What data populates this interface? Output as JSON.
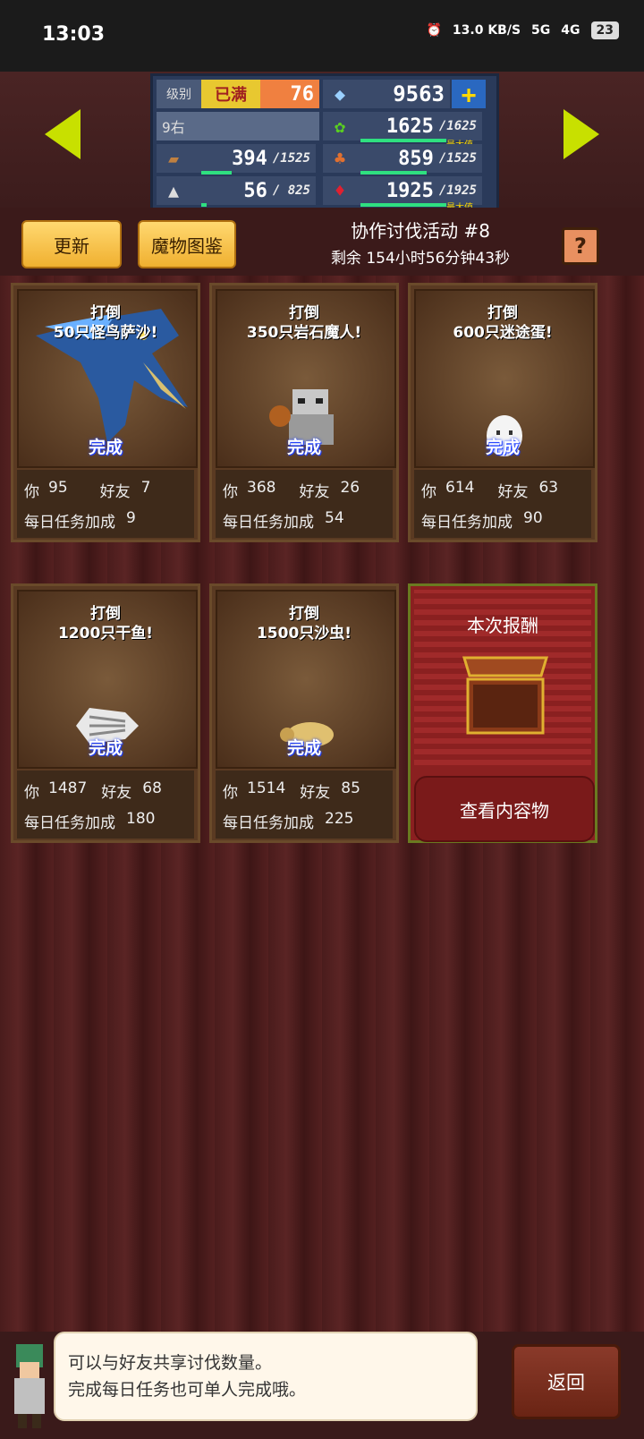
{
  "status_bar": {
    "time": "13:03",
    "net_speed": "13.0 KB/S",
    "signal1": "5G",
    "signal2": "4G",
    "battery": "23"
  },
  "stats": {
    "level_label": "级别",
    "level_status": "已满",
    "level": "76",
    "gems": "9563",
    "floor": "9右",
    "wood": "394",
    "wood_max": "/1525",
    "stone": "56",
    "stone_max": "/ 825",
    "grass": "1625",
    "grass_max": "/1625",
    "grass_note": "最大值",
    "food": "859",
    "food_max": "/1525",
    "ruby": "1925",
    "ruby_max": "/1925",
    "ruby_note": "最大值"
  },
  "header": {
    "refresh_label": "更新",
    "bestiary_label": "魔物图鉴",
    "event_title": "协作讨伐活动 #8",
    "remaining": "剩余 154小时56分钟43秒",
    "help_label": "?"
  },
  "quests": [
    {
      "line1": "打倒",
      "line2": "50只怪鸟萨沙!",
      "status": "完成",
      "you_label": "你",
      "you": "95",
      "friend_label": "好友",
      "friends": "7",
      "bonus_label": "每日任务加成",
      "bonus": "9"
    },
    {
      "line1": "打倒",
      "line2": "350只岩石魔人!",
      "status": "完成",
      "you_label": "你",
      "you": "368",
      "friend_label": "好友",
      "friends": "26",
      "bonus_label": "每日任务加成",
      "bonus": "54"
    },
    {
      "line1": "打倒",
      "line2": "600只迷途蛋!",
      "status": "完成",
      "you_label": "你",
      "you": "614",
      "friend_label": "好友",
      "friends": "63",
      "bonus_label": "每日任务加成",
      "bonus": "90"
    },
    {
      "line1": "打倒",
      "line2": "1200只干鱼!",
      "status": "完成",
      "you_label": "你",
      "you": "1487",
      "friend_label": "好友",
      "friends": "68",
      "bonus_label": "每日任务加成",
      "bonus": "180"
    },
    {
      "line1": "打倒",
      "line2": "1500只沙虫!",
      "status": "完成",
      "you_label": "你",
      "you": "1514",
      "friend_label": "好友",
      "friends": "85",
      "bonus_label": "每日任务加成",
      "bonus": "225"
    }
  ],
  "reward": {
    "label": "本次报酬",
    "button": "查看内容物"
  },
  "footer": {
    "tip_line1": "可以与好友共享讨伐数量。",
    "tip_line2": "完成每日任务也可单人完成哦。",
    "back_label": "返回"
  },
  "colors": {
    "accent_gold": "#f0b030",
    "done_blue": "#2040ff",
    "bar_green": "#2fe080"
  }
}
